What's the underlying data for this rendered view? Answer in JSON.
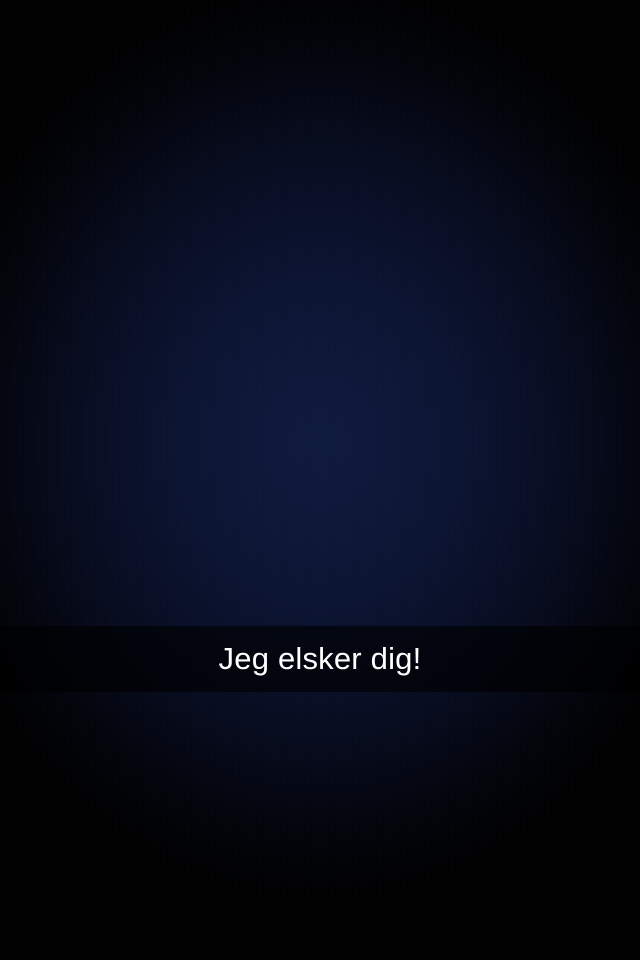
{
  "snap": {
    "caption": "Jeg elsker dig!"
  },
  "colors": {
    "background_center": "#0f1a3f",
    "background_edge": "#000000",
    "caption_text": "#ffffff",
    "caption_bar": "rgba(0,0,0,0.62)"
  }
}
